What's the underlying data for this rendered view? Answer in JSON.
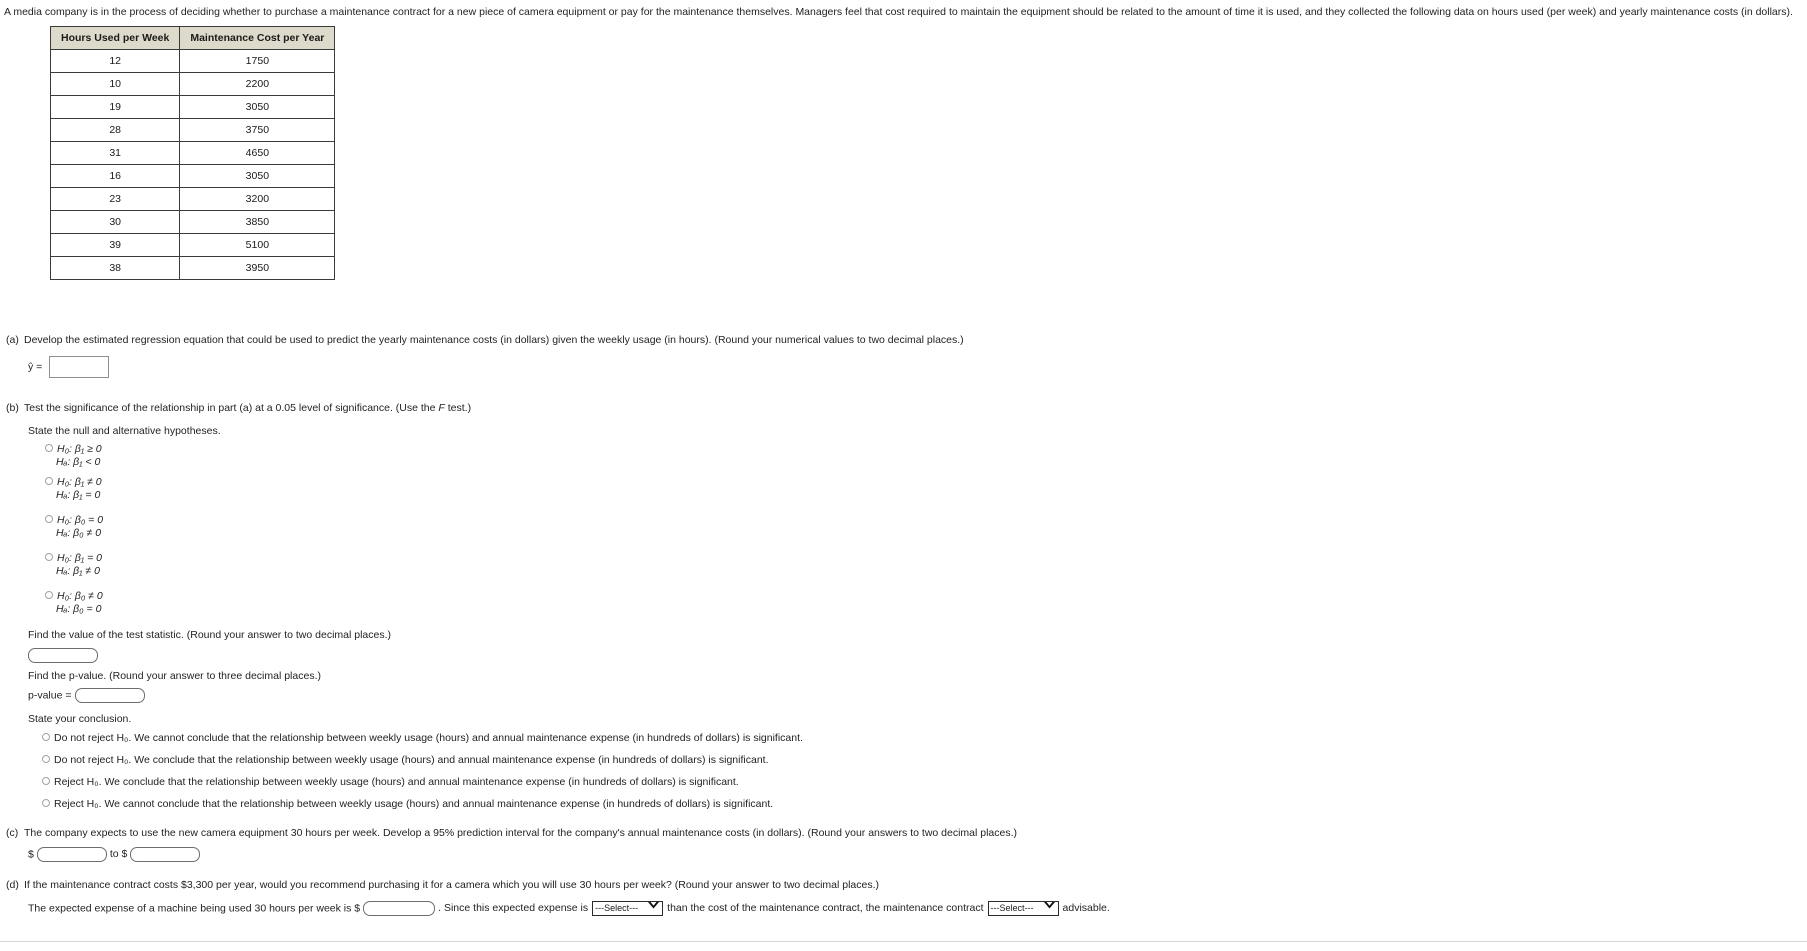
{
  "intro": "A media company is in the process of deciding whether to purchase a maintenance contract for a new piece of camera equipment or pay for the maintenance themselves. Managers feel that cost required to maintain the equipment should be related to the amount of time it is used, and they collected the following data on hours used (per week) and yearly maintenance costs (in dollars).",
  "table": {
    "headers": [
      "Hours Used per Week",
      "Maintenance Cost per Year"
    ],
    "rows": [
      [
        "12",
        "1750"
      ],
      [
        "10",
        "2200"
      ],
      [
        "19",
        "3050"
      ],
      [
        "28",
        "3750"
      ],
      [
        "31",
        "4650"
      ],
      [
        "16",
        "3050"
      ],
      [
        "23",
        "3200"
      ],
      [
        "30",
        "3850"
      ],
      [
        "39",
        "5100"
      ],
      [
        "38",
        "3950"
      ]
    ]
  },
  "parts": {
    "a": {
      "label": "(a)",
      "prompt": "Develop the estimated regression equation that could be used to predict the yearly maintenance costs (in dollars) given the weekly usage (in hours). (Round your numerical values to two decimal places.)",
      "equation_prefix": "ŷ =",
      "answer_value": ""
    },
    "b": {
      "label": "(b)",
      "prompt_pre": "Test the significance of the relationship in part (a) at a 0.05 level of significance. (Use the ",
      "prompt_italic": "F",
      "prompt_post": " test.)",
      "hypotheses_heading": "State the null and alternative hypotheses.",
      "hypotheses": [
        {
          "null": "H₀: β₁ ≥ 0",
          "alt": "Hₐ: β₁ < 0"
        },
        {
          "null": "H₀: β₁ ≠ 0",
          "alt": "Hₐ: β₁ = 0"
        },
        {
          "null": "H₀: β₀ = 0",
          "alt": "Hₐ: β₀ ≠ 0"
        },
        {
          "null": "H₀: β₁ = 0",
          "alt": "Hₐ: β₁ ≠ 0"
        },
        {
          "null": "H₀: β₀ ≠ 0",
          "alt": "Hₐ: β₀ = 0"
        }
      ],
      "test_statistic_prompt": "Find the value of the test statistic. (Round your answer to two decimal places.)",
      "test_statistic_value": "",
      "pvalue_prompt": "Find the p-value. (Round your answer to three decimal places.)",
      "pvalue_label": "p-value =",
      "pvalue_value": "",
      "conclusion_heading": "State your conclusion.",
      "conclusions": [
        "Do not reject H₀. We cannot conclude that the relationship between weekly usage (hours) and annual maintenance expense (in hundreds of dollars) is significant.",
        "Do not reject H₀. We conclude that the relationship between weekly usage (hours) and annual maintenance expense (in hundreds of dollars) is significant.",
        "Reject H₀. We conclude that the relationship between weekly usage (hours) and annual maintenance expense (in hundreds of dollars) is significant.",
        "Reject H₀. We cannot conclude that the relationship between weekly usage (hours) and annual maintenance expense (in hundreds of dollars) is significant."
      ]
    },
    "c": {
      "label": "(c)",
      "prompt": "The company expects to use the new camera equipment 30 hours per week. Develop a 95% prediction interval for the company's annual maintenance costs (in dollars). (Round your answers to two decimal places.)",
      "dollar_sign": "$",
      "lower_value": "",
      "to_text": "to $",
      "upper_value": ""
    },
    "d": {
      "label": "(d)",
      "prompt": "If the maintenance contract costs $3,300 per year, would you recommend purchasing it for a camera which you will use 30 hours per week? (Round your answer to two decimal places.)",
      "sentence_1": "The expected expense of a machine being used 30 hours per week is $",
      "expense_value": "",
      "sentence_2": ". Since this expected expense is",
      "select_1_value": "---Select---",
      "sentence_3": "than the cost of the maintenance contract, the maintenance contract",
      "select_2_value": "---Select---",
      "sentence_4": "advisable."
    }
  },
  "colors": {
    "table_header_bg": "#dedacb",
    "table_border": "#3a3a3a",
    "text": "#232323",
    "input_border": "#6d6d6d"
  }
}
